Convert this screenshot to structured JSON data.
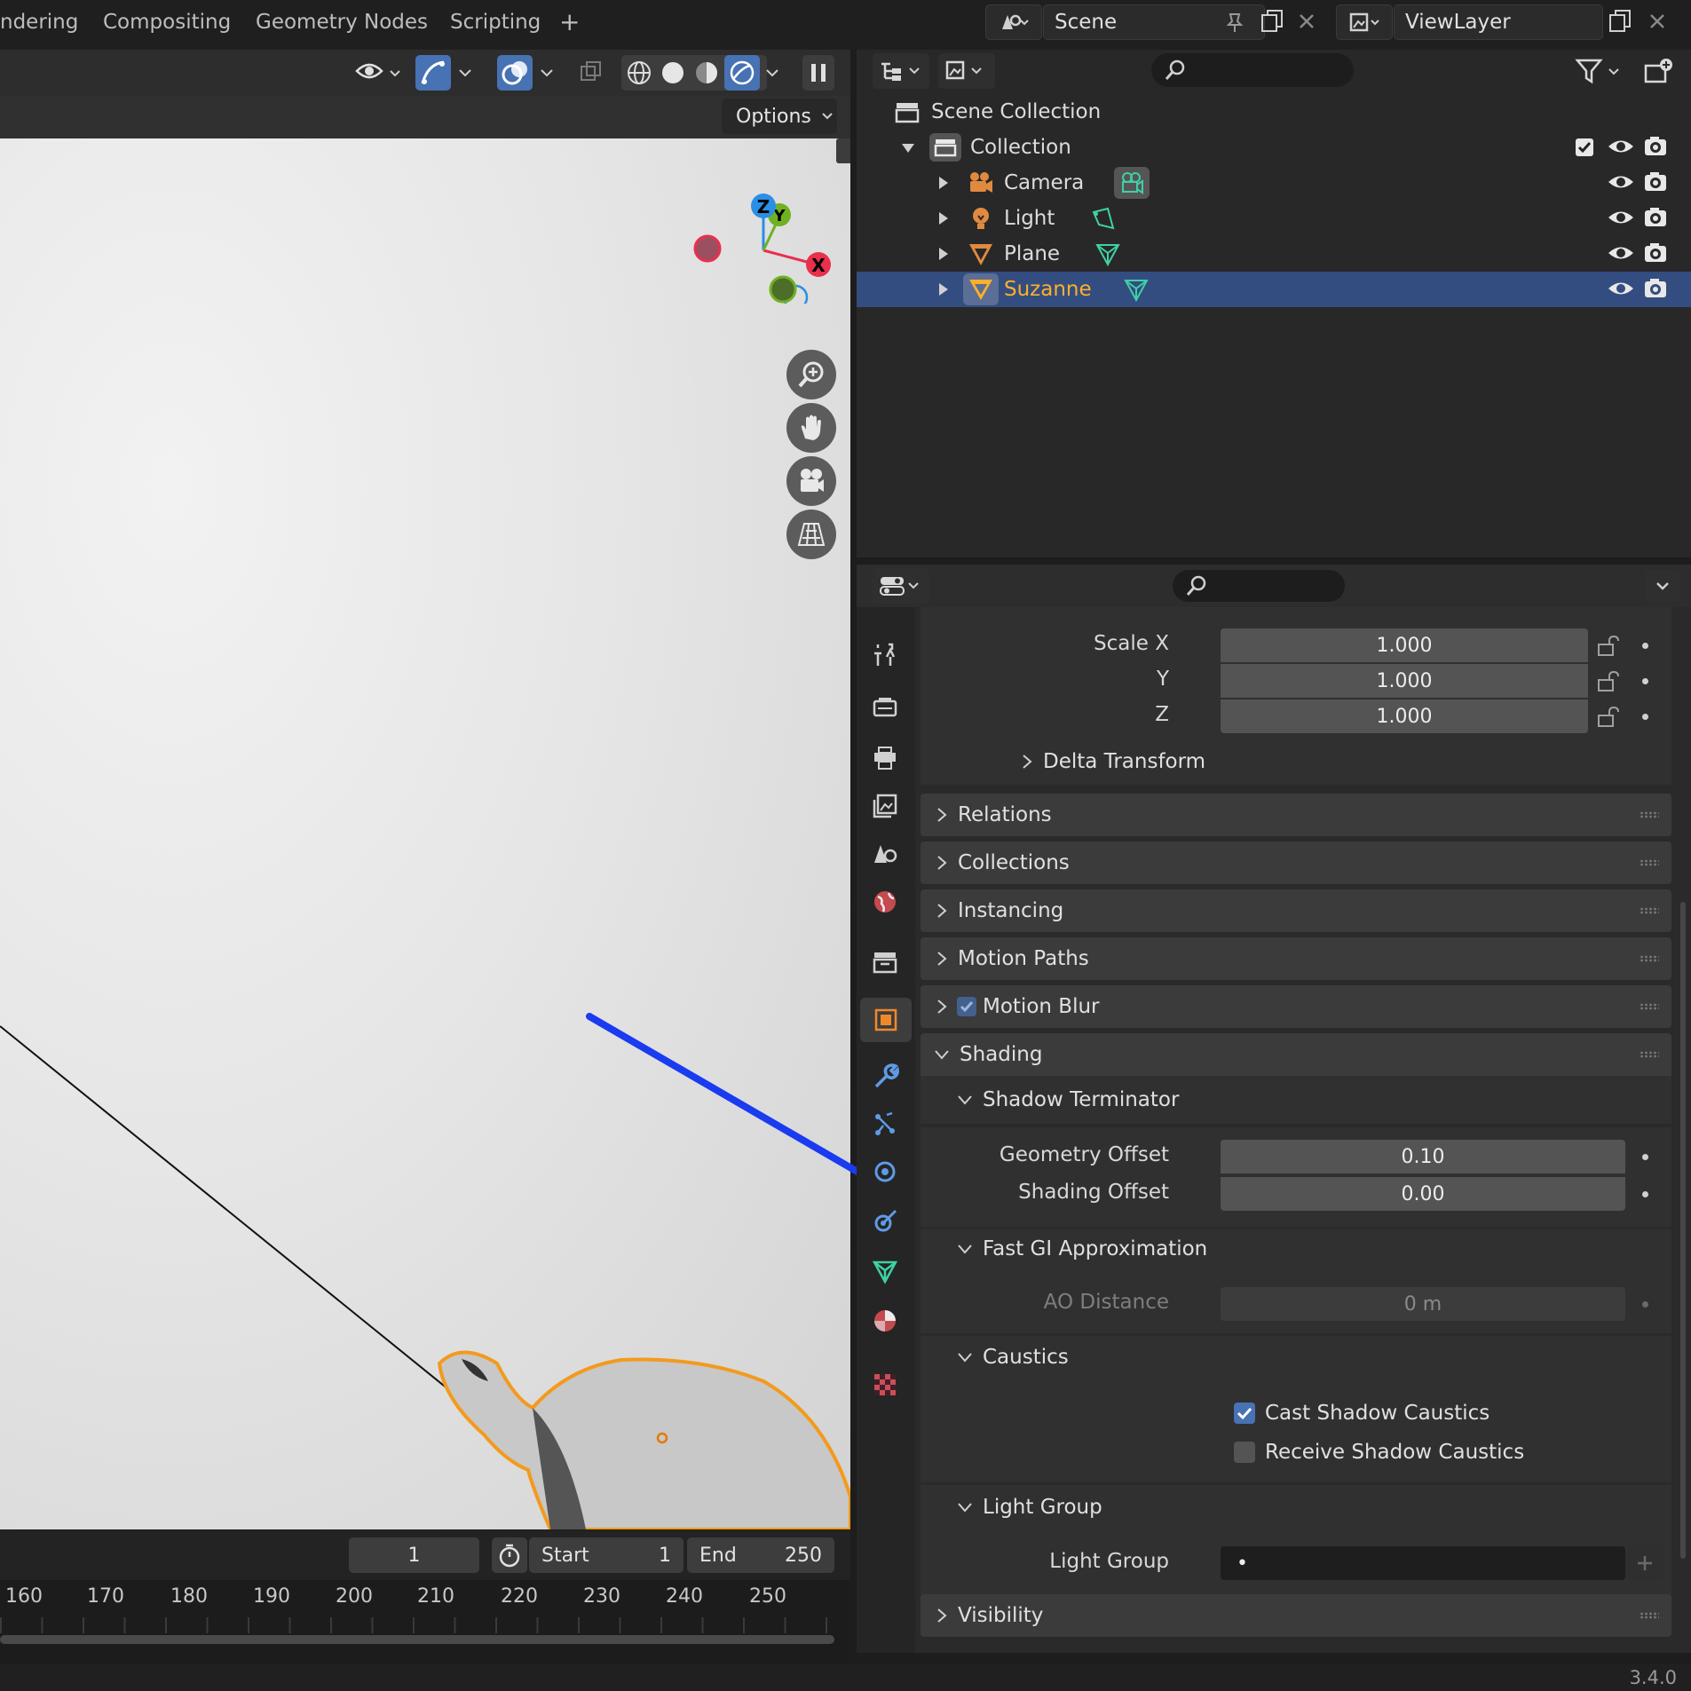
{
  "workspace_tabs": [
    "ndering",
    "Compositing",
    "Geometry Nodes",
    "Scripting",
    "+"
  ],
  "scene": {
    "name": "Scene"
  },
  "view_layer": {
    "name": "ViewLayer"
  },
  "viewport": {
    "options_label": "Options",
    "gizmo_labels": {
      "x": "X",
      "y": "Y",
      "z": "Z"
    }
  },
  "timeline": {
    "current_frame": "1",
    "start_label": "Start",
    "start_value": "1",
    "end_label": "End",
    "end_value": "250",
    "ticks": [
      "160",
      "170",
      "180",
      "190",
      "200",
      "210",
      "220",
      "230",
      "240",
      "250"
    ]
  },
  "outliner": {
    "root": "Scene Collection",
    "collection": "Collection",
    "items": [
      {
        "label": "Camera",
        "icon": "camera-icon",
        "data_icon": "camera-data-icon"
      },
      {
        "label": "Light",
        "icon": "light-icon",
        "data_icon": "light-data-icon"
      },
      {
        "label": "Plane",
        "icon": "mesh-icon",
        "data_icon": "mesh-data-icon"
      },
      {
        "label": "Suzanne",
        "icon": "mesh-icon",
        "data_icon": "mesh-data-icon",
        "selected": true
      }
    ]
  },
  "properties": {
    "scale": {
      "label": "Scale X",
      "x": "1.000",
      "y_label": "Y",
      "y": "1.000",
      "z_label": "Z",
      "z": "1.000"
    },
    "delta_transform": "Delta Transform",
    "panels": [
      "Relations",
      "Collections",
      "Instancing",
      "Motion Paths",
      "Motion Blur"
    ],
    "shading": {
      "title": "Shading",
      "shadow_terminator": "Shadow Terminator",
      "geometry_offset_label": "Geometry Offset",
      "geometry_offset": "0.10",
      "shading_offset_label": "Shading Offset",
      "shading_offset": "0.00",
      "fast_gi": "Fast GI Approximation",
      "ao_distance_label": "AO Distance",
      "ao_distance": "0 m",
      "caustics": "Caustics",
      "cast_shadow_caustics": "Cast Shadow Caustics",
      "receive_shadow_caustics": "Receive Shadow Caustics"
    },
    "light_group": {
      "title": "Light Group",
      "label": "Light Group",
      "value": "•"
    },
    "visibility": "Visibility"
  },
  "status": {
    "version": "3.4.0"
  },
  "colors": {
    "accent": "#4772b3",
    "selected_row": "#334d80",
    "active_object_text": "#ffaf29",
    "annotation_arrow": "#1a3bf0",
    "x_axis": "#e8304c",
    "y_axis": "#6fb120",
    "z_axis": "#2a8fe6"
  }
}
